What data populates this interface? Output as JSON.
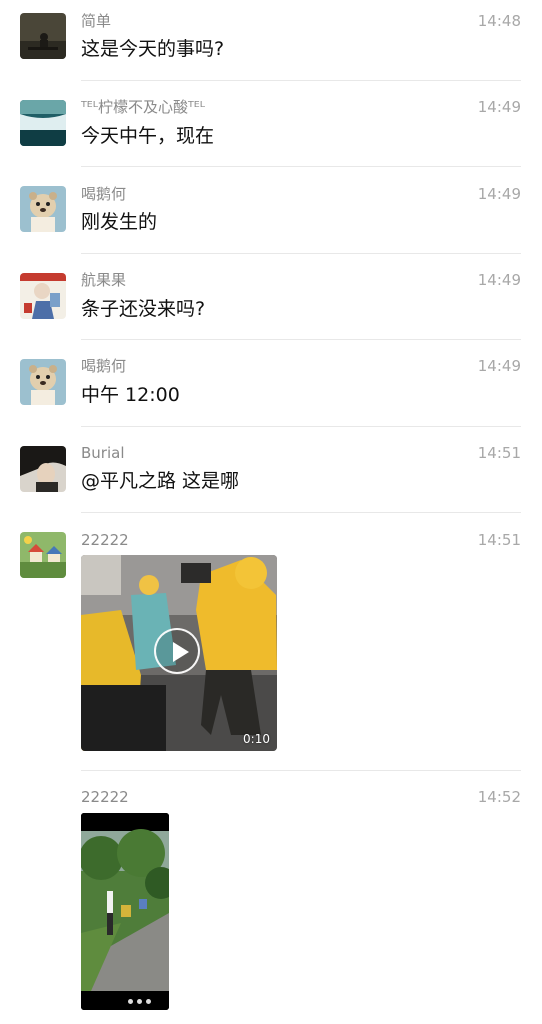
{
  "messages": [
    {
      "sender": "简单",
      "time": "14:48",
      "text": "这是今天的事吗?"
    },
    {
      "sender": "ᵀᴱᴸ柠檬不及心酸ᵀᴱᴸ",
      "time": "14:49",
      "text": "今天中午，现在"
    },
    {
      "sender": "喝鹅何",
      "time": "14:49",
      "text": "刚发生的"
    },
    {
      "sender": "航果果",
      "time": "14:49",
      "text": "条子还没来吗?"
    },
    {
      "sender": "喝鹅何",
      "time": "14:49",
      "text": "中午 12:00"
    },
    {
      "sender": "Burial",
      "time": "14:51",
      "text": "@平凡之路 这是哪"
    },
    {
      "sender": "22222",
      "time": "14:51",
      "video_duration": "0:10"
    },
    {
      "sender": "22222",
      "time": "14:52"
    }
  ],
  "icons": {
    "video_play": "play-icon"
  },
  "colors": {
    "background": "#ffffff",
    "name_text": "#8a8a8a",
    "time_text": "#a8a8a8",
    "message_text": "#111111"
  }
}
